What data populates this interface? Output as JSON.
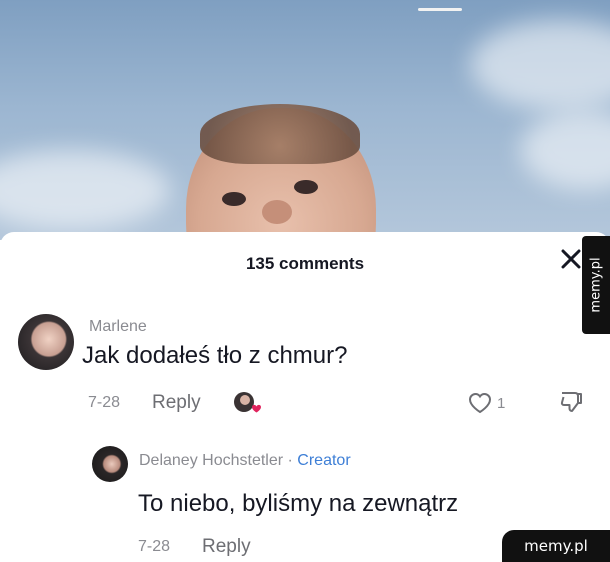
{
  "sheet": {
    "title": "135 comments"
  },
  "comments": [
    {
      "username": "Marlene",
      "text": "Jak dodałeś tło z chmur?",
      "date": "7-28",
      "reply_label": "Reply",
      "like_count": "1"
    }
  ],
  "reply": {
    "username": "Delaney Hochstetler",
    "separator": " · ",
    "badge": "Creator",
    "text": "To niebo, byliśmy na zewnątrz",
    "date": "7-28",
    "reply_label": "Reply"
  },
  "watermarks": {
    "side": "memy.pl",
    "bottom": "memy.pl"
  },
  "icons": {
    "close": "close-icon",
    "heart": "heart-icon",
    "dislike": "dislike-icon",
    "creator_liked": "creator-liked-icon"
  },
  "colors": {
    "creator_badge": "#3e7fd6",
    "muted_text": "#8a8b91",
    "primary_text": "#161823",
    "like_heart_accent": "#e0245e"
  }
}
